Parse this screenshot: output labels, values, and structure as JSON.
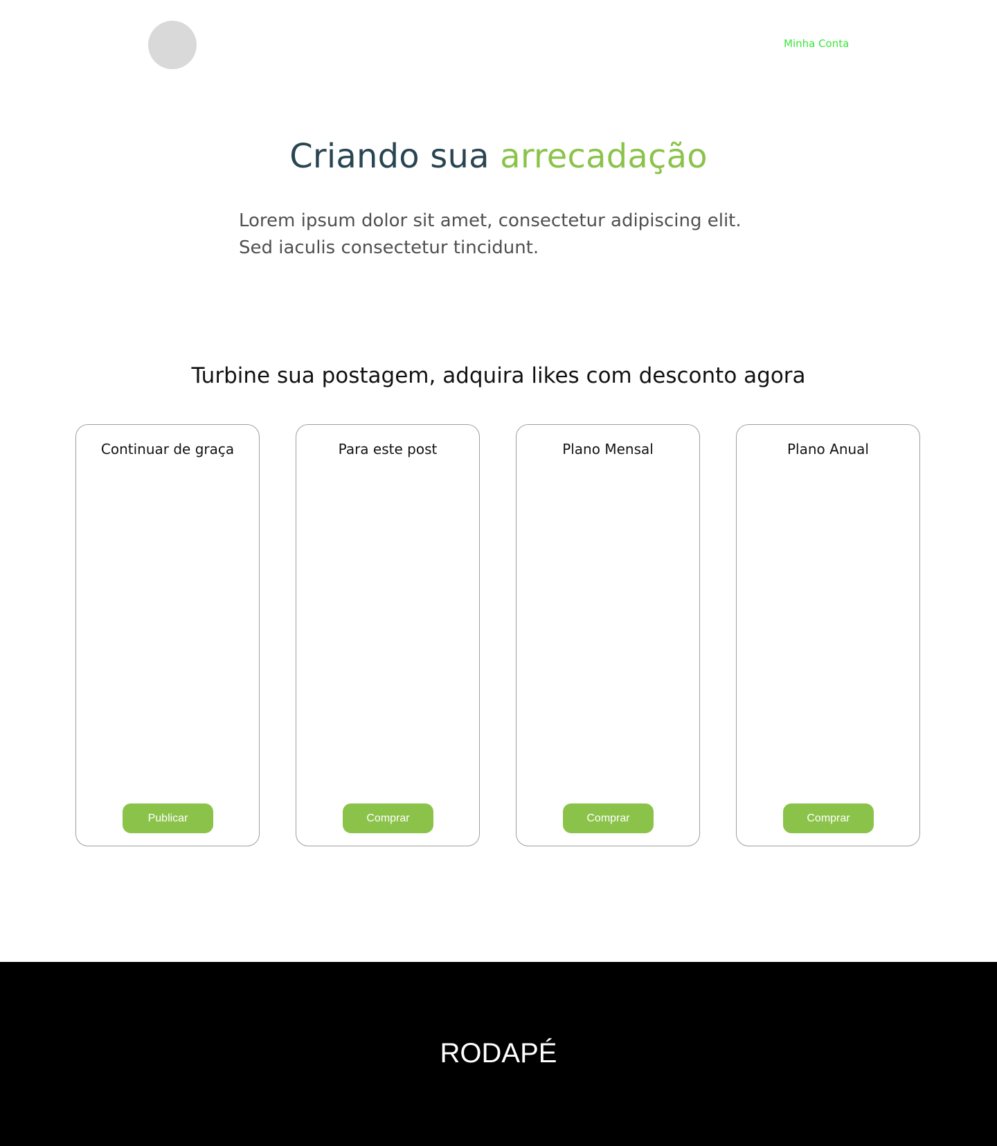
{
  "header": {
    "account_link": "Minha Conta"
  },
  "hero": {
    "title_main": "Criando sua",
    "title_accent": "arrecadação",
    "description": "Lorem ipsum dolor sit amet, consectetur adipiscing elit. Sed iaculis consectetur tincidunt."
  },
  "plans_section": {
    "heading": "Turbine sua postagem, adquira likes com desconto agora",
    "plans": [
      {
        "name": "Continuar de graça",
        "button_label": "Publicar"
      },
      {
        "name": "Para este post",
        "button_label": "Comprar"
      },
      {
        "name": "Plano Mensal",
        "button_label": "Comprar"
      },
      {
        "name": "Plano Anual",
        "button_label": "Comprar"
      }
    ]
  },
  "footer": {
    "label": "RODAPÉ"
  },
  "colors": {
    "accent_green": "#8bc34a",
    "link_green": "#39e639",
    "title_dark": "#2a4552",
    "avatar_gray": "#d9d9d9",
    "footer_bg": "#000000"
  }
}
